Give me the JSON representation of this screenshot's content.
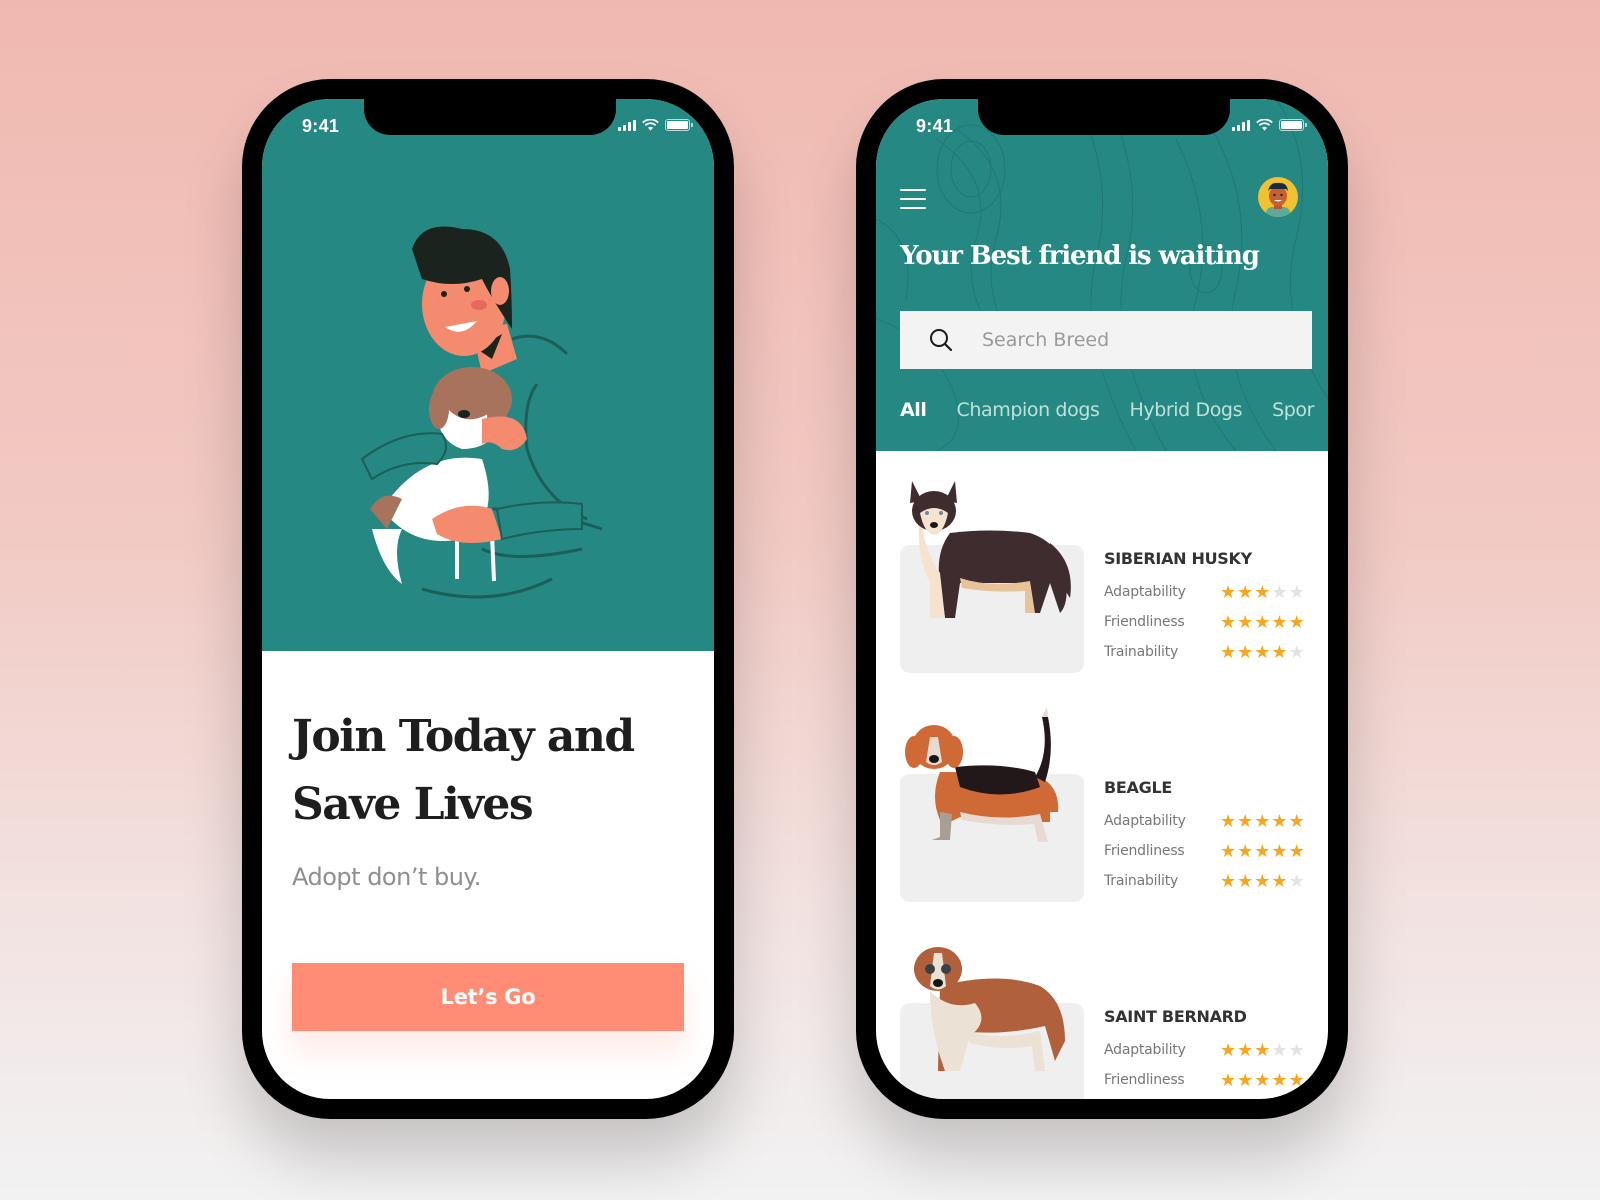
{
  "status_bar": {
    "time": "9:41"
  },
  "onboarding": {
    "headline_line1": "Join Today and",
    "headline_line2": "Save Lives",
    "subline": "Adopt don’t buy.",
    "cta_label": "Let’s Go",
    "illustration": "man-hugging-beagle-illustration"
  },
  "browse": {
    "title": "Your Best friend is waiting",
    "menu_icon": "hamburger-menu-icon",
    "avatar_icon": "user-avatar",
    "search": {
      "placeholder": "Search Breed",
      "value": "",
      "icon": "search-icon"
    },
    "tabs": [
      {
        "label": "All",
        "active": true
      },
      {
        "label": "Champion dogs",
        "active": false
      },
      {
        "label": "Hybrid Dogs",
        "active": false
      },
      {
        "label": "Spor",
        "active": false
      }
    ],
    "breeds": [
      {
        "name": "SIBERIAN HUSKY",
        "traits": [
          {
            "label": "Adaptability",
            "rating": 3,
            "max": 5
          },
          {
            "label": "Friendliness",
            "rating": 5,
            "max": 5
          },
          {
            "label": "Trainability",
            "rating": 4,
            "max": 5
          }
        ]
      },
      {
        "name": "BEAGLE",
        "traits": [
          {
            "label": "Adaptability",
            "rating": 5,
            "max": 5
          },
          {
            "label": "Friendliness",
            "rating": 5,
            "max": 5
          },
          {
            "label": "Trainability",
            "rating": 4,
            "max": 5
          }
        ]
      },
      {
        "name": "SAINT BERNARD",
        "traits": [
          {
            "label": "Adaptability",
            "rating": 3,
            "max": 5
          },
          {
            "label": "Friendliness",
            "rating": 5,
            "max": 5
          }
        ]
      }
    ]
  },
  "colors": {
    "teal": "#268882",
    "coral": "#ff8d76",
    "star": "#f8a61f",
    "star_off": "#e3e3e3"
  }
}
